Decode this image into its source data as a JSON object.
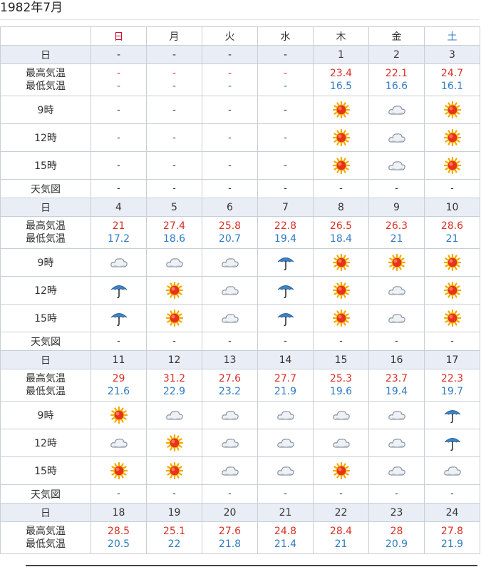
{
  "title": "1982年7月",
  "weekdays": [
    "日",
    "月",
    "火",
    "水",
    "木",
    "金",
    "土"
  ],
  "labels": {
    "date": "日",
    "temp_hi": "最高気温",
    "temp_lo": "最低気温",
    "h9": "9時",
    "h12": "12時",
    "h15": "15時",
    "map": "天気図"
  },
  "dash": "-",
  "colors": {
    "sunday": "#c8102e",
    "saturday": "#2f7bc4",
    "high": "#d93025",
    "low": "#2f7bc4",
    "date_row_bg": "#e9eef6"
  },
  "weeks": [
    {
      "dates": [
        "-",
        "-",
        "-",
        "-",
        "1",
        "2",
        "3"
      ],
      "hi": [
        "-",
        "-",
        "-",
        "-",
        "23.4",
        "22.1",
        "24.7"
      ],
      "lo": [
        "-",
        "-",
        "-",
        "-",
        "16.5",
        "16.6",
        "16.1"
      ],
      "h9": [
        "-",
        "-",
        "-",
        "-",
        "sun",
        "cloud",
        "sun"
      ],
      "h12": [
        "-",
        "-",
        "-",
        "-",
        "sun",
        "cloud",
        "sun"
      ],
      "h15": [
        "-",
        "-",
        "-",
        "-",
        "sun",
        "cloud",
        "sun"
      ],
      "map": [
        "-",
        "-",
        "-",
        "-",
        "-",
        "-",
        "-"
      ]
    },
    {
      "dates": [
        "4",
        "5",
        "6",
        "7",
        "8",
        "9",
        "10"
      ],
      "hi": [
        "21",
        "27.4",
        "25.8",
        "22.8",
        "26.5",
        "26.3",
        "28.6"
      ],
      "lo": [
        "17.2",
        "18.6",
        "20.7",
        "19.4",
        "18.4",
        "21",
        "21"
      ],
      "h9": [
        "cloud",
        "cloud",
        "cloud",
        "umbrella",
        "sun",
        "sun",
        "sun"
      ],
      "h12": [
        "umbrella",
        "sun",
        "cloud",
        "umbrella",
        "sun",
        "cloud",
        "sun"
      ],
      "h15": [
        "umbrella",
        "sun",
        "cloud",
        "umbrella",
        "sun",
        "cloud",
        "sun"
      ],
      "map": [
        "-",
        "-",
        "-",
        "-",
        "-",
        "-",
        "-"
      ]
    },
    {
      "dates": [
        "11",
        "12",
        "13",
        "14",
        "15",
        "16",
        "17"
      ],
      "hi": [
        "29",
        "31.2",
        "27.6",
        "27.7",
        "25.3",
        "23.7",
        "22.3"
      ],
      "lo": [
        "21.6",
        "22.9",
        "23.2",
        "21.9",
        "19.6",
        "19.4",
        "19.7"
      ],
      "h9": [
        "sun",
        "cloud",
        "cloud",
        "cloud",
        "cloud",
        "cloud",
        "umbrella"
      ],
      "h12": [
        "cloud",
        "sun",
        "cloud",
        "cloud",
        "cloud",
        "cloud",
        "umbrella"
      ],
      "h15": [
        "sun",
        "sun",
        "cloud",
        "cloud",
        "sun",
        "cloud",
        "cloud"
      ],
      "map": [
        "-",
        "-",
        "-",
        "-",
        "-",
        "-",
        "-"
      ]
    },
    {
      "dates": [
        "18",
        "19",
        "20",
        "21",
        "22",
        "23",
        "24"
      ],
      "hi": [
        "28.5",
        "25.1",
        "27.6",
        "24.8",
        "28.4",
        "28",
        "27.8"
      ],
      "lo": [
        "20.5",
        "22",
        "21.8",
        "21.4",
        "21",
        "20.9",
        "21.9"
      ]
    }
  ]
}
